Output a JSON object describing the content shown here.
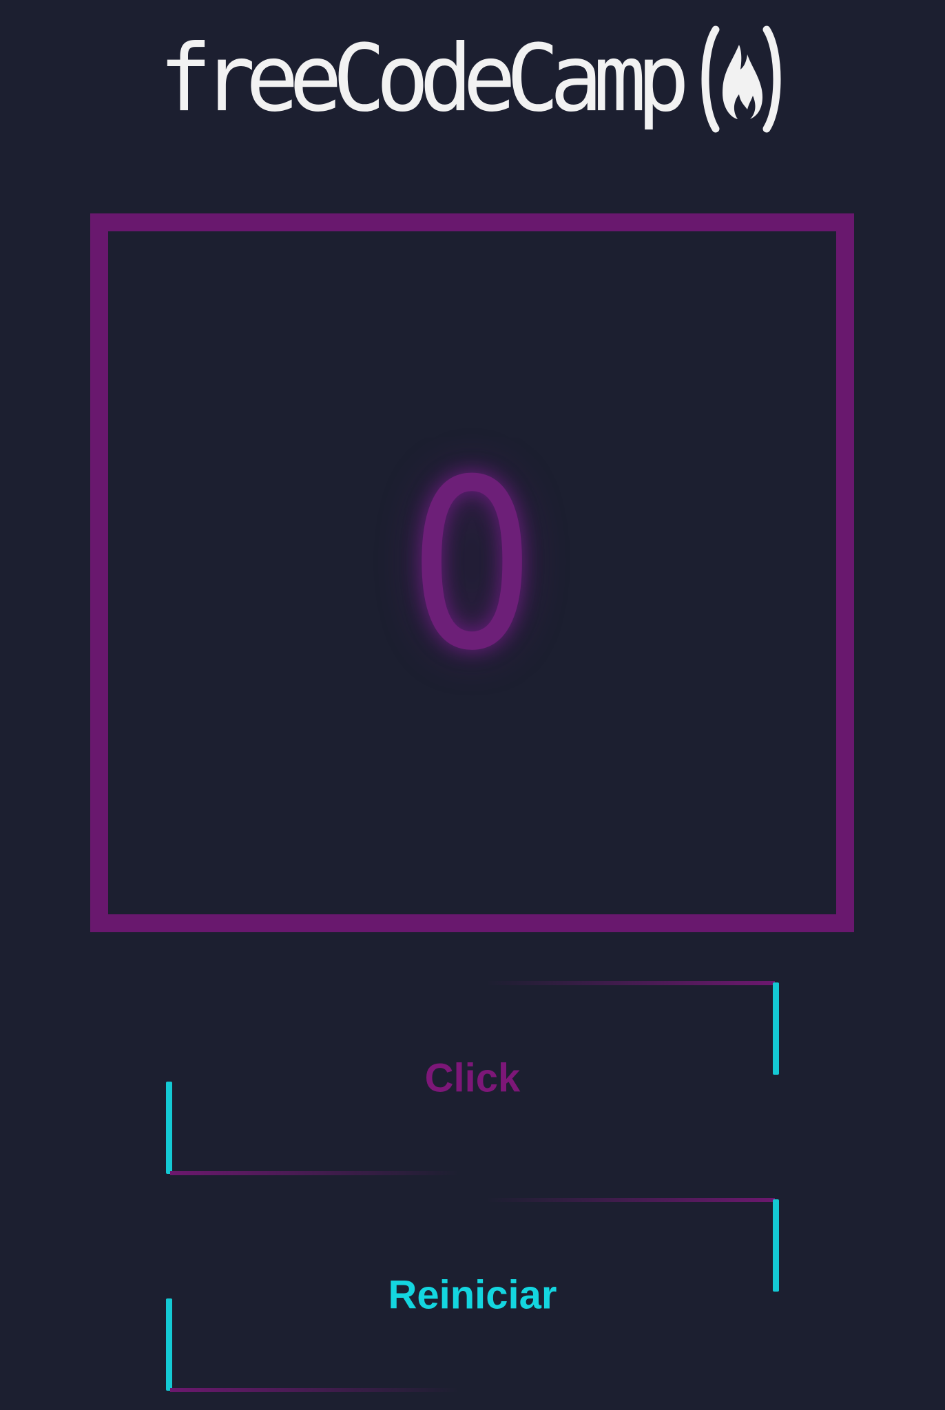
{
  "logo": {
    "text": "freeCodeCamp",
    "icon": "flame-icon"
  },
  "counter": {
    "value": "0"
  },
  "buttons": {
    "click_label": "Click",
    "reset_label": "Reiniciar"
  },
  "colors": {
    "background": "#1c1f30",
    "accent_purple": "#69186e",
    "accent_cyan": "#14d6e0",
    "logo_text": "#f2f2f2"
  }
}
